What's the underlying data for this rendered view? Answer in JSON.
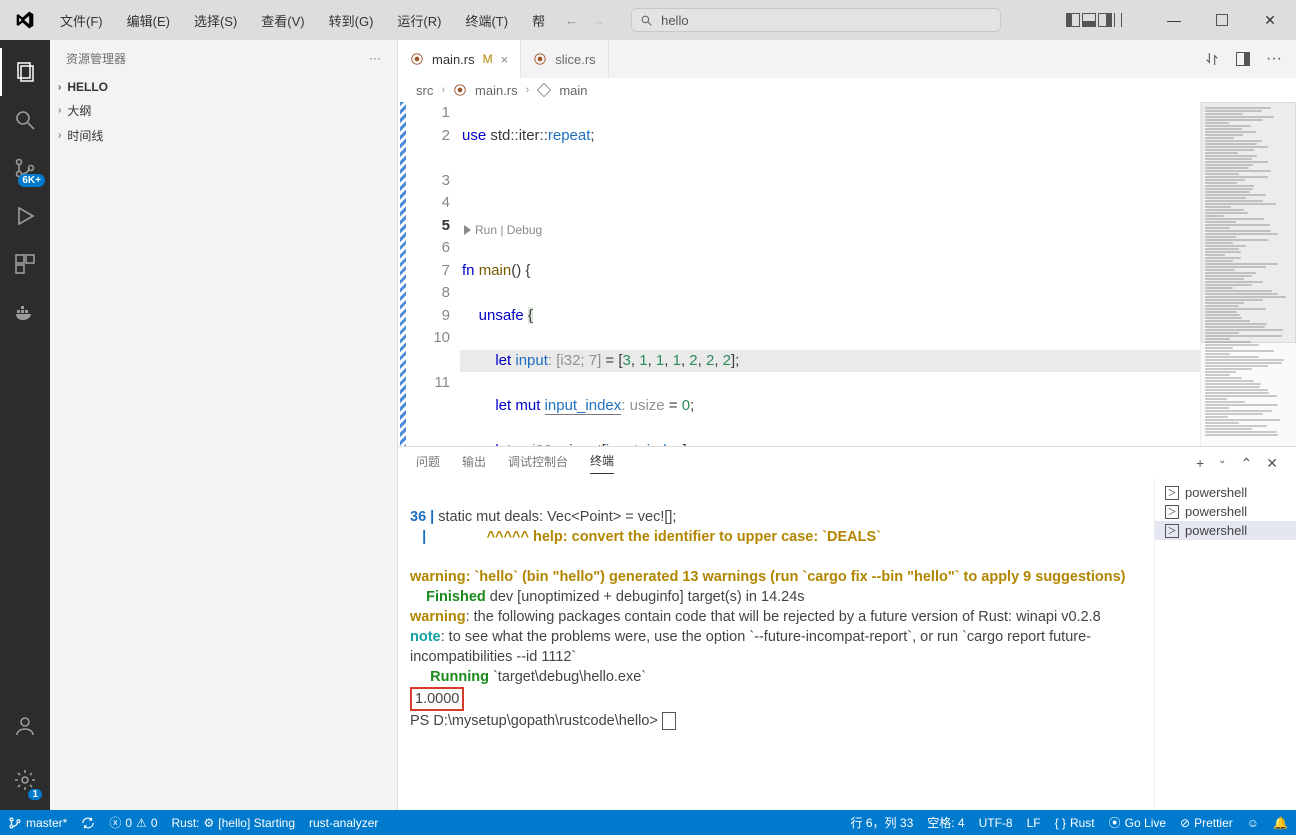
{
  "titlebar": {
    "menus": [
      "文件(F)",
      "编辑(E)",
      "选择(S)",
      "查看(V)",
      "转到(G)",
      "运行(R)",
      "终端(T)",
      "帮"
    ],
    "search_text": "hello"
  },
  "activity": {
    "scm_badge": "6K+",
    "settings_badge": "1"
  },
  "sidebar": {
    "title": "资源管理器",
    "sections": [
      "HELLO",
      "大纲",
      "时间线"
    ]
  },
  "tabs": {
    "items": [
      {
        "icon": "rust",
        "label": "main.rs",
        "modified": "M",
        "close": "×",
        "active": true
      },
      {
        "icon": "rust",
        "label": "slice.rs",
        "modified": "",
        "close": "",
        "active": false
      }
    ]
  },
  "breadcrumb": {
    "parts": [
      "src",
      "main.rs",
      "main"
    ]
  },
  "codelens": "▶ Run | Debug",
  "code": {
    "lines": [
      {
        "n": "1",
        "t": "use"
      },
      {
        "n": "2",
        "t": "blank"
      },
      {
        "n": "",
        "t": "codelens"
      },
      {
        "n": "3",
        "t": "fn"
      },
      {
        "n": "4",
        "t": "unsafe"
      },
      {
        "n": "5",
        "t": "let_input"
      },
      {
        "n": "6",
        "t": "let_mut_idx"
      },
      {
        "n": "7",
        "t": "let_n"
      },
      {
        "n": "8",
        "t": "comment"
      },
      {
        "n": "9",
        "t": "idx_inc"
      },
      {
        "n": "10",
        "t": "points"
      },
      {
        "n": "",
        "t": "collect1"
      },
      {
        "n": "11",
        "t": "merge"
      },
      {
        "n": "",
        "t": "collect2"
      }
    ]
  },
  "panel": {
    "tabs": [
      "问题",
      "输出",
      "调试控制台",
      "终端"
    ],
    "active": 3,
    "terminals": [
      "powershell",
      "powershell",
      "powershell"
    ],
    "term_active": 2
  },
  "terminal": {
    "l1_num": "36",
    "l1_pipe": " | ",
    "l1_code": "static mut deals: Vec<Point> = vec![];",
    "l2_pipe": "   | ",
    "l2_caret": "              ^^^^^ ",
    "l2_help": "help: convert the identifier to upper case: `DEALS`",
    "w1a": "warning",
    "w1b": ": `hello` (bin \"hello\") generated 13 warnings (run `cargo fix --bin \"hello\"` to apply 9 suggestions)",
    "fin_a": "    Finished",
    "fin_b": " dev [unoptimized + debuginfo] target(s) in 14.24s",
    "w2a": "warning",
    "w2b": ": the following packages contain code that will be rejected by a future version of Rust: winapi v0.2.8",
    "n_a": "note",
    "n_b": ": to see what the problems were, use the option `--future-incompat-report`, or run `cargo report future-incompatibilities --id 1112`",
    "run_a": "     Running",
    "run_b": " `target\\debug\\hello.exe`",
    "out": "1.0000",
    "prompt": "PS D:\\mysetup\\gopath\\rustcode\\hello> "
  },
  "status": {
    "branch": "master*",
    "errors": "0",
    "warnings": "0",
    "rust": "Rust:",
    "rust_status": "[hello] Starting",
    "analyzer": "rust-analyzer",
    "pos": "行 6，列 33",
    "spaces": "空格: 4",
    "enc": "UTF-8",
    "eol": "LF",
    "lang": "Rust",
    "golive": "Go Live",
    "prettier": "Prettier"
  }
}
